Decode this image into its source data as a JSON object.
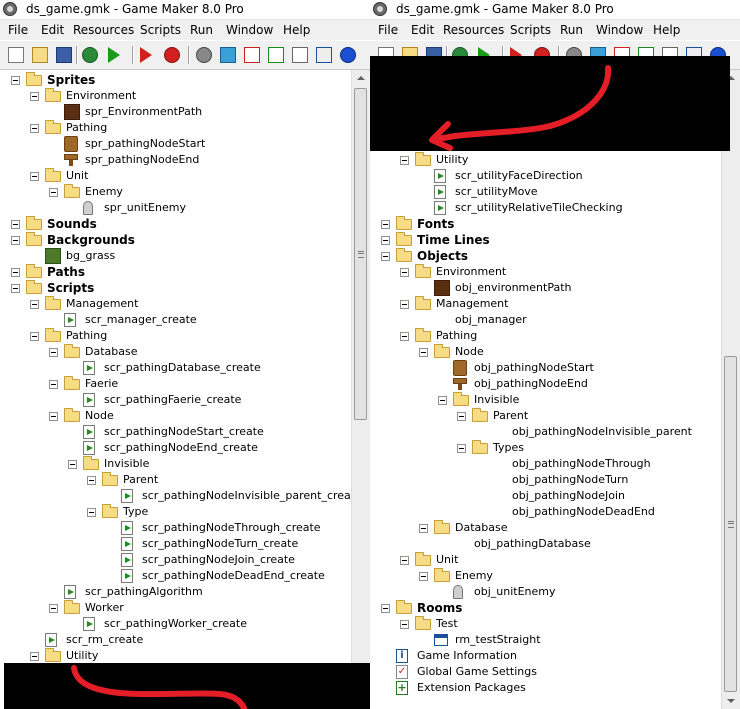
{
  "window_title": "ds_game.gmk - Game Maker 8.0 Pro",
  "menu": [
    "File",
    "Edit",
    "Resources",
    "Scripts",
    "Run",
    "Window",
    "Help"
  ],
  "toolbar_icons": [
    "new-icon",
    "open-icon",
    "save-icon",
    "publish-icon",
    "run-icon",
    "run-debug-icon",
    "add-sprite-icon",
    "add-sound-icon",
    "add-background-icon",
    "add-path-icon",
    "add-script-icon",
    "add-font-icon",
    "add-timeline-icon",
    "add-object-icon"
  ],
  "scribble_color": "#e41e26",
  "left_tree": [
    {
      "d": 0,
      "t": "folder",
      "l": "Sprites",
      "b": true
    },
    {
      "d": 1,
      "t": "folder",
      "l": "Environment"
    },
    {
      "d": 2,
      "t": "sprite-brown",
      "l": "spr_EnvironmentPath"
    },
    {
      "d": 1,
      "t": "folder",
      "l": "Pathing"
    },
    {
      "d": 2,
      "t": "node-start",
      "l": "spr_pathingNodeStart"
    },
    {
      "d": 2,
      "t": "node-end",
      "l": "spr_pathingNodeEnd"
    },
    {
      "d": 1,
      "t": "folder",
      "l": "Unit"
    },
    {
      "d": 2,
      "t": "folder",
      "l": "Enemy"
    },
    {
      "d": 3,
      "t": "ghost",
      "l": "spr_unitEnemy"
    },
    {
      "d": 0,
      "t": "folder",
      "l": "Sounds",
      "b": true
    },
    {
      "d": 0,
      "t": "folder",
      "l": "Backgrounds",
      "b": true
    },
    {
      "d": 1,
      "t": "bg-green",
      "l": "bg_grass"
    },
    {
      "d": 0,
      "t": "folder",
      "l": "Paths",
      "b": true
    },
    {
      "d": 0,
      "t": "folder",
      "l": "Scripts",
      "b": true
    },
    {
      "d": 1,
      "t": "folder",
      "l": "Management"
    },
    {
      "d": 2,
      "t": "script",
      "l": "scr_manager_create"
    },
    {
      "d": 1,
      "t": "folder",
      "l": "Pathing"
    },
    {
      "d": 2,
      "t": "folder",
      "l": "Database"
    },
    {
      "d": 3,
      "t": "script",
      "l": "scr_pathingDatabase_create"
    },
    {
      "d": 2,
      "t": "folder",
      "l": "Faerie"
    },
    {
      "d": 3,
      "t": "script",
      "l": "scr_pathingFaerie_create"
    },
    {
      "d": 2,
      "t": "folder",
      "l": "Node"
    },
    {
      "d": 3,
      "t": "script",
      "l": "scr_pathingNodeStart_create"
    },
    {
      "d": 3,
      "t": "script",
      "l": "scr_pathingNodeEnd_create"
    },
    {
      "d": 3,
      "t": "folder",
      "l": "Invisible"
    },
    {
      "d": 4,
      "t": "folder",
      "l": "Parent"
    },
    {
      "d": 5,
      "t": "script",
      "l": "scr_pathingNodeInvisible_parent_create"
    },
    {
      "d": 4,
      "t": "folder",
      "l": "Type"
    },
    {
      "d": 5,
      "t": "script",
      "l": "scr_pathingNodeThrough_create"
    },
    {
      "d": 5,
      "t": "script",
      "l": "scr_pathingNodeTurn_create"
    },
    {
      "d": 5,
      "t": "script",
      "l": "scr_pathingNodeJoin_create"
    },
    {
      "d": 5,
      "t": "script",
      "l": "scr_pathingNodeDeadEnd_create"
    },
    {
      "d": 2,
      "t": "script",
      "l": "scr_pathingAlgorithm"
    },
    {
      "d": 2,
      "t": "folder",
      "l": "Worker"
    },
    {
      "d": 3,
      "t": "script",
      "l": "scr_pathingWorker_create"
    },
    {
      "d": 1,
      "t": "script",
      "l": "scr_rm_create"
    },
    {
      "d": 1,
      "t": "folder",
      "l": "Utility"
    }
  ],
  "right_tree": [
    {
      "d": 1,
      "t": "folder",
      "l": "Utility"
    },
    {
      "d": 2,
      "t": "script",
      "l": "scr_utilityFaceDirection"
    },
    {
      "d": 2,
      "t": "script",
      "l": "scr_utilityMove"
    },
    {
      "d": 2,
      "t": "script",
      "l": "scr_utilityRelativeTileChecking"
    },
    {
      "d": 0,
      "t": "folder",
      "l": "Fonts",
      "b": true
    },
    {
      "d": 0,
      "t": "folder",
      "l": "Time Lines",
      "b": true
    },
    {
      "d": 0,
      "t": "folder",
      "l": "Objects",
      "b": true
    },
    {
      "d": 1,
      "t": "folder",
      "l": "Environment"
    },
    {
      "d": 2,
      "t": "sprite-brown",
      "l": "obj_environmentPath"
    },
    {
      "d": 1,
      "t": "folder",
      "l": "Management"
    },
    {
      "d": 2,
      "t": "none",
      "l": "obj_manager"
    },
    {
      "d": 1,
      "t": "folder",
      "l": "Pathing"
    },
    {
      "d": 2,
      "t": "folder",
      "l": "Node"
    },
    {
      "d": 3,
      "t": "node-start",
      "l": "obj_pathingNodeStart"
    },
    {
      "d": 3,
      "t": "node-end",
      "l": "obj_pathingNodeEnd"
    },
    {
      "d": 3,
      "t": "folder",
      "l": "Invisible"
    },
    {
      "d": 4,
      "t": "folder",
      "l": "Parent"
    },
    {
      "d": 5,
      "t": "none",
      "l": "obj_pathingNodeInvisible_parent"
    },
    {
      "d": 4,
      "t": "folder",
      "l": "Types"
    },
    {
      "d": 5,
      "t": "none",
      "l": "obj_pathingNodeThrough"
    },
    {
      "d": 5,
      "t": "none",
      "l": "obj_pathingNodeTurn"
    },
    {
      "d": 5,
      "t": "none",
      "l": "obj_pathingNodeJoin"
    },
    {
      "d": 5,
      "t": "none",
      "l": "obj_pathingNodeDeadEnd"
    },
    {
      "d": 2,
      "t": "folder",
      "l": "Database"
    },
    {
      "d": 3,
      "t": "none",
      "l": "obj_pathingDatabase"
    },
    {
      "d": 1,
      "t": "folder",
      "l": "Unit"
    },
    {
      "d": 2,
      "t": "folder",
      "l": "Enemy"
    },
    {
      "d": 3,
      "t": "ghost",
      "l": "obj_unitEnemy"
    },
    {
      "d": 0,
      "t": "folder",
      "l": "Rooms",
      "b": true
    },
    {
      "d": 1,
      "t": "folder",
      "l": "Test"
    },
    {
      "d": 2,
      "t": "room",
      "l": "rm_testStraight"
    },
    {
      "d": 0,
      "t": "info",
      "l": "Game Information"
    },
    {
      "d": 0,
      "t": "check",
      "l": "Global Game Settings"
    },
    {
      "d": 0,
      "t": "ext",
      "l": "Extension Packages"
    }
  ]
}
